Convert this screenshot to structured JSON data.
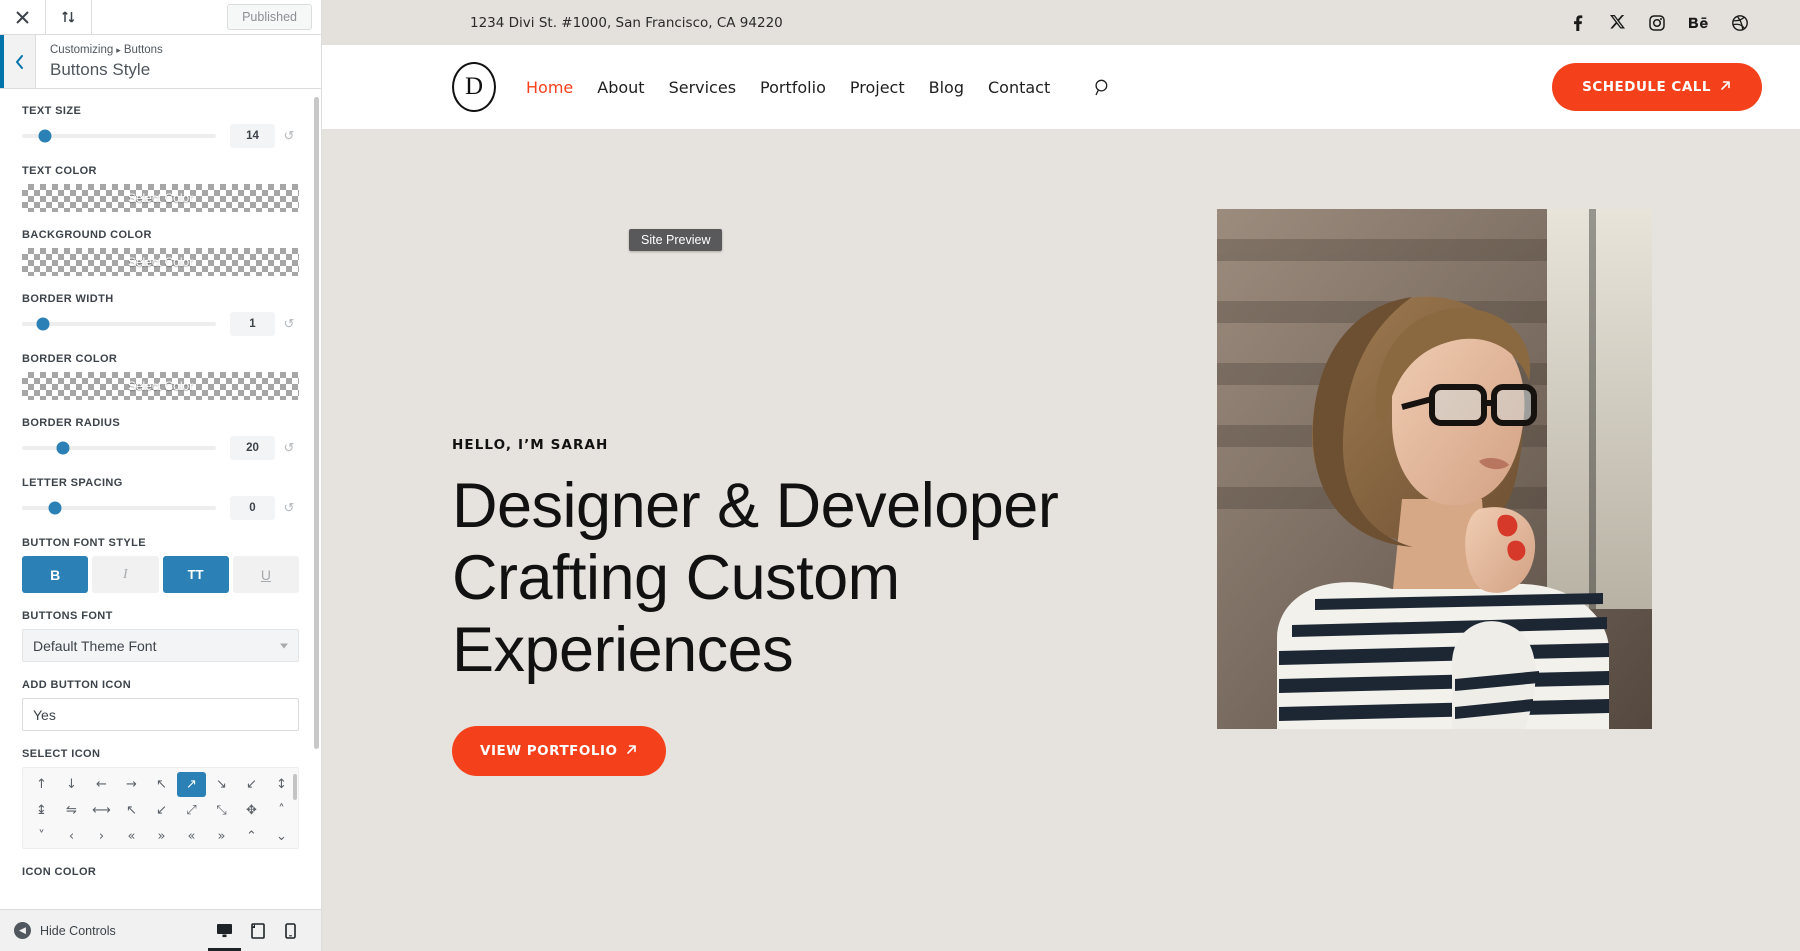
{
  "customizer": {
    "topbar": {
      "close_label": "Close",
      "devices_label": "Change previewing device",
      "published_label": "Published"
    },
    "header": {
      "back_label": "Back",
      "breadcrumb_parent": "Customizing",
      "breadcrumb_sep": "▸",
      "breadcrumb_current": "Buttons",
      "panel_title": "Buttons Style"
    },
    "controls": [
      {
        "type": "slider",
        "label": "TEXT SIZE",
        "value": "14",
        "knob_pct": 12
      },
      {
        "type": "color",
        "label": "TEXT COLOR",
        "value": "Select Color"
      },
      {
        "type": "color",
        "label": "BACKGROUND COLOR",
        "value": "Select Color"
      },
      {
        "type": "slider",
        "label": "BORDER WIDTH",
        "value": "1",
        "knob_pct": 11
      },
      {
        "type": "color",
        "label": "BORDER COLOR",
        "value": "Select Color"
      },
      {
        "type": "slider",
        "label": "BORDER RADIUS",
        "value": "20",
        "knob_pct": 21
      },
      {
        "type": "slider",
        "label": "LETTER SPACING",
        "value": "0",
        "knob_pct": 17
      }
    ],
    "font_style": {
      "label": "BUTTON FONT STYLE",
      "buttons": [
        {
          "name": "bold",
          "glyph": "B",
          "active": true
        },
        {
          "name": "italic",
          "glyph": "I",
          "active": false
        },
        {
          "name": "uppercase",
          "glyph": "TT",
          "active": true
        },
        {
          "name": "underline",
          "glyph": "U",
          "active": false
        }
      ]
    },
    "buttons_font": {
      "label": "BUTTONS FONT",
      "value": "Default Theme Font"
    },
    "add_button_icon": {
      "label": "ADD BUTTON ICON",
      "value": "Yes"
    },
    "select_icon": {
      "label": "SELECT ICON",
      "selected_index": 5,
      "icons": [
        "↑",
        "↓",
        "←",
        "→",
        "↖",
        "↗",
        "↘",
        "↙",
        "↕",
        "↨",
        "⇋",
        "⟷",
        "↖",
        "↙",
        "⤢",
        "⤡",
        "✥",
        "˄",
        "˅",
        "‹",
        "›",
        "«",
        "»",
        "«",
        "»",
        "⌃",
        "⌄"
      ]
    },
    "icon_color": {
      "label": "ICON COLOR"
    },
    "footer": {
      "hide_controls": "Hide Controls",
      "devices": [
        {
          "name": "desktop",
          "active": true
        },
        {
          "name": "tablet",
          "active": false
        },
        {
          "name": "mobile",
          "active": false
        }
      ]
    }
  },
  "preview": {
    "tooltip": "Site Preview",
    "topbar": {
      "address": "1234 Divi St. #1000, San Francisco, CA 94220",
      "socials": [
        "facebook",
        "x-twitter",
        "instagram",
        "behance",
        "dribbble"
      ]
    },
    "nav": {
      "logo_letter": "D",
      "links": [
        {
          "label": "Home",
          "active": true
        },
        {
          "label": "About",
          "active": false
        },
        {
          "label": "Services",
          "active": false
        },
        {
          "label": "Portfolio",
          "active": false
        },
        {
          "label": "Project",
          "active": false
        },
        {
          "label": "Blog",
          "active": false
        },
        {
          "label": "Contact",
          "active": false
        }
      ],
      "search_icon": "search-icon",
      "cta_label": "SCHEDULE CALL"
    },
    "hero": {
      "eyebrow": "HELLO, I’M SARAH",
      "heading_line1": "Designer & Developer",
      "heading_line2": "Crafting Custom",
      "heading_line3": "Experiences",
      "cta_label": "VIEW PORTFOLIO",
      "image_alt": "Woman with glasses in striped shirt looking out a window"
    }
  },
  "colors": {
    "accent_orange": "#f5411b",
    "customizer_blue": "#2b81b5",
    "hero_bg": "#e6e2dd",
    "topbar_bg": "#e4e0db",
    "tooltip_bg": "#59595b"
  }
}
